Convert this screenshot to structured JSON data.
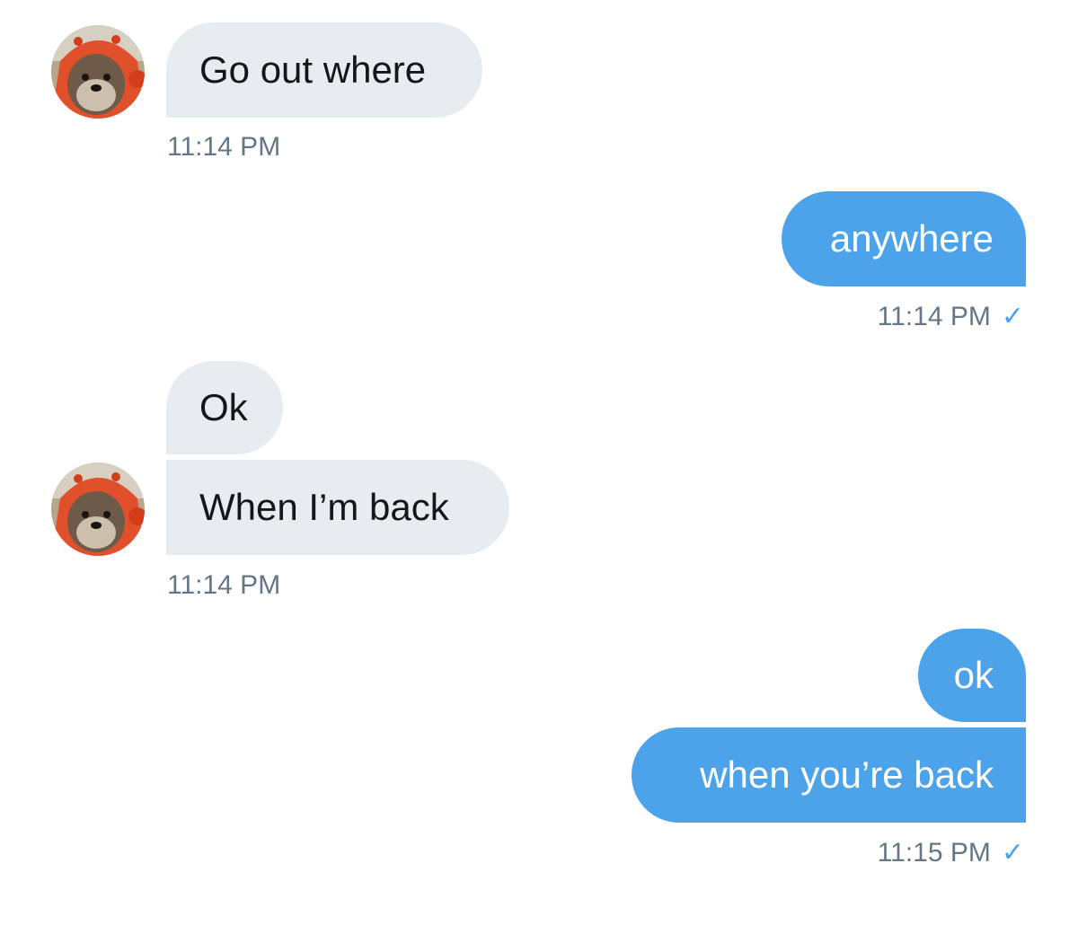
{
  "messages": [
    {
      "direction": "incoming",
      "text": "Go out where"
    },
    {
      "direction": "outgoing",
      "text": "anywhere"
    },
    {
      "direction": "incoming",
      "text": "Ok"
    },
    {
      "direction": "incoming",
      "text": "When I’m back"
    },
    {
      "direction": "outgoing",
      "text": "ok"
    },
    {
      "direction": "outgoing",
      "text": "when you’re back"
    }
  ],
  "timestamps": [
    {
      "text": "11:14 PM"
    },
    {
      "text": "11:14 PM",
      "read_receipt": "✓"
    },
    {
      "text": "11:14 PM"
    },
    {
      "text": "11:15 PM",
      "read_receipt": "✓"
    }
  ],
  "colors": {
    "incoming_bubble": "#e6ecf0",
    "outgoing_bubble": "#4da3ea",
    "timestamp_text": "#657786",
    "read_check": "#4da3ea"
  }
}
